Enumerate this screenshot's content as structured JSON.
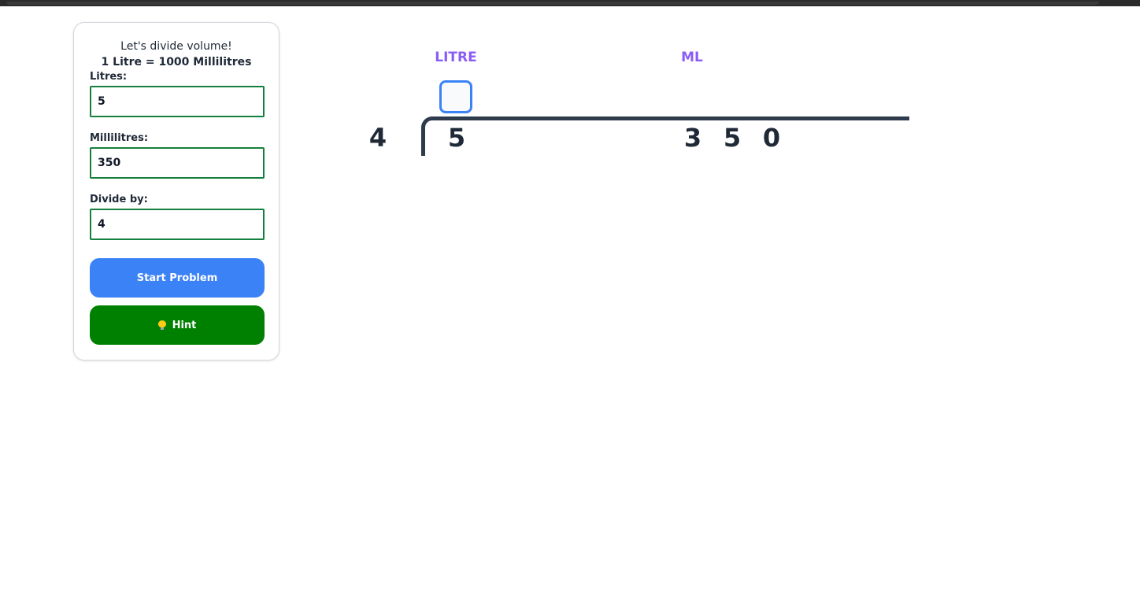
{
  "panel": {
    "intro": "Let's divide volume!",
    "rule": "1 Litre = 1000 Millilitres",
    "litres_label": "Litres:",
    "litres_value": "5",
    "ml_label": "Millilitres:",
    "ml_value": "350",
    "divisor_label": "Divide by:",
    "divisor_value": "4",
    "start_button": "Start Problem",
    "hint_button": "Hint",
    "hint_icon": "lightbulb-icon"
  },
  "division": {
    "litre_header": "LITRE",
    "ml_header": "ML",
    "answer_value": "",
    "divisor": "4",
    "litre_digit": "5",
    "ml_digits": [
      "3",
      "5",
      "0"
    ]
  },
  "colors": {
    "accent_blue": "#3b82f6",
    "hint_green": "#008000",
    "input_border": "#15803d",
    "header_purple": "#8b5cf6",
    "bracket": "#2d3b4c"
  }
}
